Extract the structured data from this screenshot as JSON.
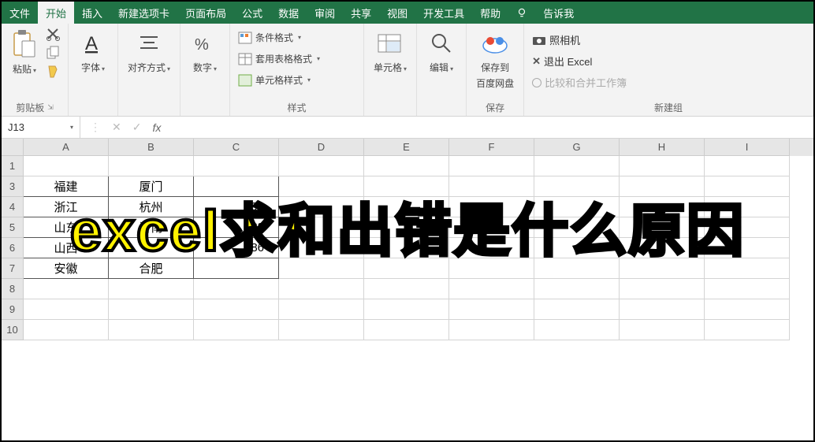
{
  "menu": {
    "file": "文件",
    "home": "开始",
    "insert": "插入",
    "newtab": "新建选项卡",
    "pagelayout": "页面布局",
    "formulas": "公式",
    "data": "数据",
    "review": "审阅",
    "share": "共享",
    "view": "视图",
    "devtools": "开发工具",
    "help": "帮助",
    "tellme": "告诉我"
  },
  "ribbon": {
    "clipboard": {
      "paste": "粘贴",
      "group": "剪贴板"
    },
    "font": {
      "label": "字体"
    },
    "align": {
      "label": "对齐方式"
    },
    "number": {
      "label": "数字"
    },
    "styles": {
      "conditional": "条件格式",
      "tableformat": "套用表格格式",
      "cellstyle": "单元格样式",
      "group": "样式"
    },
    "cells": {
      "label": "单元格"
    },
    "editing": {
      "label": "编辑"
    },
    "save": {
      "label1": "保存到",
      "label2": "百度网盘",
      "group": "保存"
    },
    "newgroup": {
      "camera": "照相机",
      "exit": "退出 Excel",
      "compare": "比较和合并工作簿",
      "group": "新建组"
    }
  },
  "formula_bar": {
    "name": "J13"
  },
  "columns": [
    "A",
    "B",
    "C",
    "D",
    "E",
    "F",
    "G",
    "H",
    "I"
  ],
  "rows": [
    "1",
    "3",
    "4",
    "5",
    "6",
    "7",
    "8",
    "9",
    "10"
  ],
  "table": {
    "r3": {
      "a": "福建",
      "b": "厦门",
      "c": ""
    },
    "r4": {
      "a": "浙江",
      "b": "杭州",
      "c": "98"
    },
    "r5": {
      "a": "山东",
      "b": "济南",
      "c": "83"
    },
    "r6": {
      "a": "山西",
      "b": "",
      "c": "86"
    },
    "r7": {
      "a": "安徽",
      "b": "合肥",
      "c": ""
    }
  },
  "overlay": "excel求和出错是什么原因"
}
